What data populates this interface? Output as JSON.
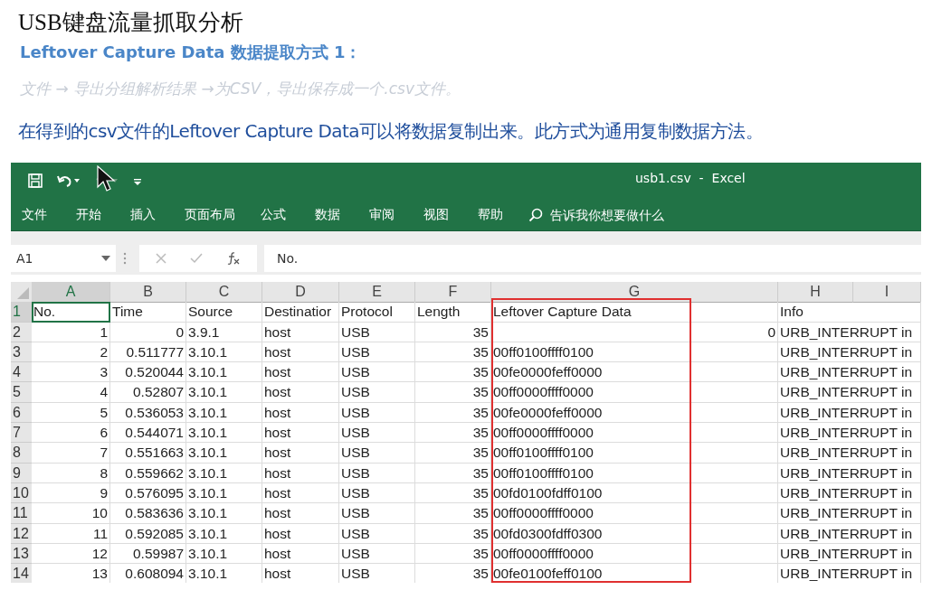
{
  "slide": {
    "title": "USB键盘流量抓取分析",
    "subtitle": "Leftover Capture Data 数据提取方式 1：",
    "step": "文件 → 导出分组解析结果 →为CSV，导出保存成一个.csv文件。",
    "note": "在得到的csv文件的Leftover Capture Data可以将数据复制出来。此方式为通用复制数据方法。"
  },
  "window": {
    "title": "usb1.csv  -  Excel"
  },
  "ribbon_tabs": [
    "文件",
    "开始",
    "插入",
    "页面布局",
    "公式",
    "数据",
    "审阅",
    "视图",
    "帮助"
  ],
  "tell_me": {
    "placeholder": "告诉我你想要做什么"
  },
  "name_box": "A1",
  "formula": "No.",
  "columns": [
    {
      "label": "A",
      "selected": true
    },
    {
      "label": "B",
      "selected": false
    },
    {
      "label": "C",
      "selected": false
    },
    {
      "label": "D",
      "selected": false
    },
    {
      "label": "E",
      "selected": false
    },
    {
      "label": "F",
      "selected": false
    },
    {
      "label": "G",
      "selected": false
    },
    {
      "label": "H",
      "selected": false
    },
    {
      "label": "I",
      "selected": false
    }
  ],
  "header_row": {
    "number": "1",
    "selected": true,
    "cells": [
      "No.",
      "Time",
      "Source",
      "Destinatior",
      "Protocol",
      "Length",
      "Leftover Capture Data",
      "Info"
    ]
  },
  "rows": [
    {
      "number": "2",
      "data_numeric": true,
      "cells": [
        "1",
        "0",
        "3.9.1",
        "host",
        "USB",
        "35",
        "0",
        "URB_INTERRUPT in"
      ]
    },
    {
      "number": "3",
      "data_numeric": false,
      "cells": [
        "2",
        "0.511777",
        "3.10.1",
        "host",
        "USB",
        "35",
        "00ff0100ffff0100",
        "URB_INTERRUPT in"
      ]
    },
    {
      "number": "4",
      "data_numeric": false,
      "cells": [
        "3",
        "0.520044",
        "3.10.1",
        "host",
        "USB",
        "35",
        "00fe0000feff0000",
        "URB_INTERRUPT in"
      ]
    },
    {
      "number": "5",
      "data_numeric": false,
      "cells": [
        "4",
        "0.52807",
        "3.10.1",
        "host",
        "USB",
        "35",
        "00ff0000ffff0000",
        "URB_INTERRUPT in"
      ]
    },
    {
      "number": "6",
      "data_numeric": false,
      "cells": [
        "5",
        "0.536053",
        "3.10.1",
        "host",
        "USB",
        "35",
        "00fe0000feff0000",
        "URB_INTERRUPT in"
      ]
    },
    {
      "number": "7",
      "data_numeric": false,
      "cells": [
        "6",
        "0.544071",
        "3.10.1",
        "host",
        "USB",
        "35",
        "00ff0000ffff0000",
        "URB_INTERRUPT in"
      ]
    },
    {
      "number": "8",
      "data_numeric": false,
      "cells": [
        "7",
        "0.551663",
        "3.10.1",
        "host",
        "USB",
        "35",
        "00ff0100ffff0100",
        "URB_INTERRUPT in"
      ]
    },
    {
      "number": "9",
      "data_numeric": false,
      "cells": [
        "8",
        "0.559662",
        "3.10.1",
        "host",
        "USB",
        "35",
        "00ff0100ffff0100",
        "URB_INTERRUPT in"
      ]
    },
    {
      "number": "10",
      "data_numeric": false,
      "cells": [
        "9",
        "0.576095",
        "3.10.1",
        "host",
        "USB",
        "35",
        "00fd0100fdff0100",
        "URB_INTERRUPT in"
      ]
    },
    {
      "number": "11",
      "data_numeric": false,
      "cells": [
        "10",
        "0.583636",
        "3.10.1",
        "host",
        "USB",
        "35",
        "00ff0000ffff0000",
        "URB_INTERRUPT in"
      ]
    },
    {
      "number": "12",
      "data_numeric": false,
      "cells": [
        "11",
        "0.592085",
        "3.10.1",
        "host",
        "USB",
        "35",
        "00fd0300fdff0300",
        "URB_INTERRUPT in"
      ]
    },
    {
      "number": "13",
      "data_numeric": false,
      "cells": [
        "12",
        "0.59987",
        "3.10.1",
        "host",
        "USB",
        "35",
        "00ff0000ffff0000",
        "URB_INTERRUPT in"
      ]
    },
    {
      "number": "14",
      "data_numeric": false,
      "cells": [
        "13",
        "0.608094",
        "3.10.1",
        "host",
        "USB",
        "35",
        "00fe0100feff0100",
        "URB_INTERRUPT in"
      ]
    }
  ]
}
